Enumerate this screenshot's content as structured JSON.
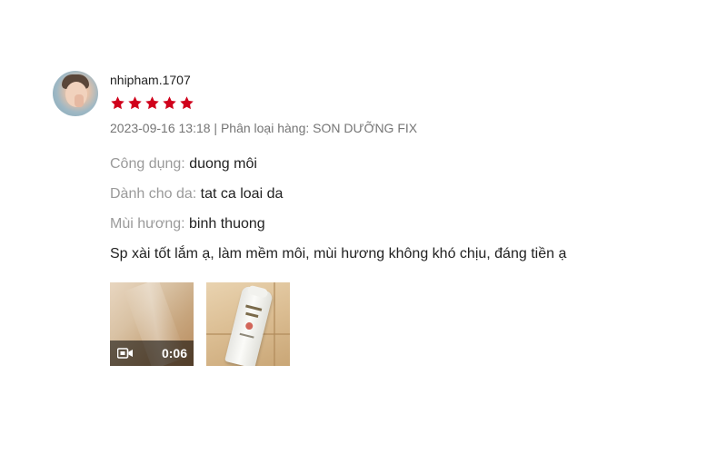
{
  "review": {
    "username": "nhipham.1707",
    "rating": 5,
    "meta": "2023-09-16 13:18 | Phân loại hàng: SON DƯỠNG FIX",
    "attributes": [
      {
        "key": "Công dụng:",
        "value": "duong môi"
      },
      {
        "key": "Dành cho da:",
        "value": "tat ca loai da"
      },
      {
        "key": "Mùi hương:",
        "value": "binh thuong"
      }
    ],
    "comment": "Sp xài tốt lắm ạ, làm mềm môi, mùi hương không khó chịu, đáng tiền ạ",
    "media": [
      {
        "type": "video",
        "icon": "video-camera-icon",
        "duration": "0:06"
      },
      {
        "type": "photo"
      }
    ]
  },
  "colors": {
    "star": "#d0011b",
    "meta_text": "#757575",
    "attr_key": "#9a9a9a"
  }
}
